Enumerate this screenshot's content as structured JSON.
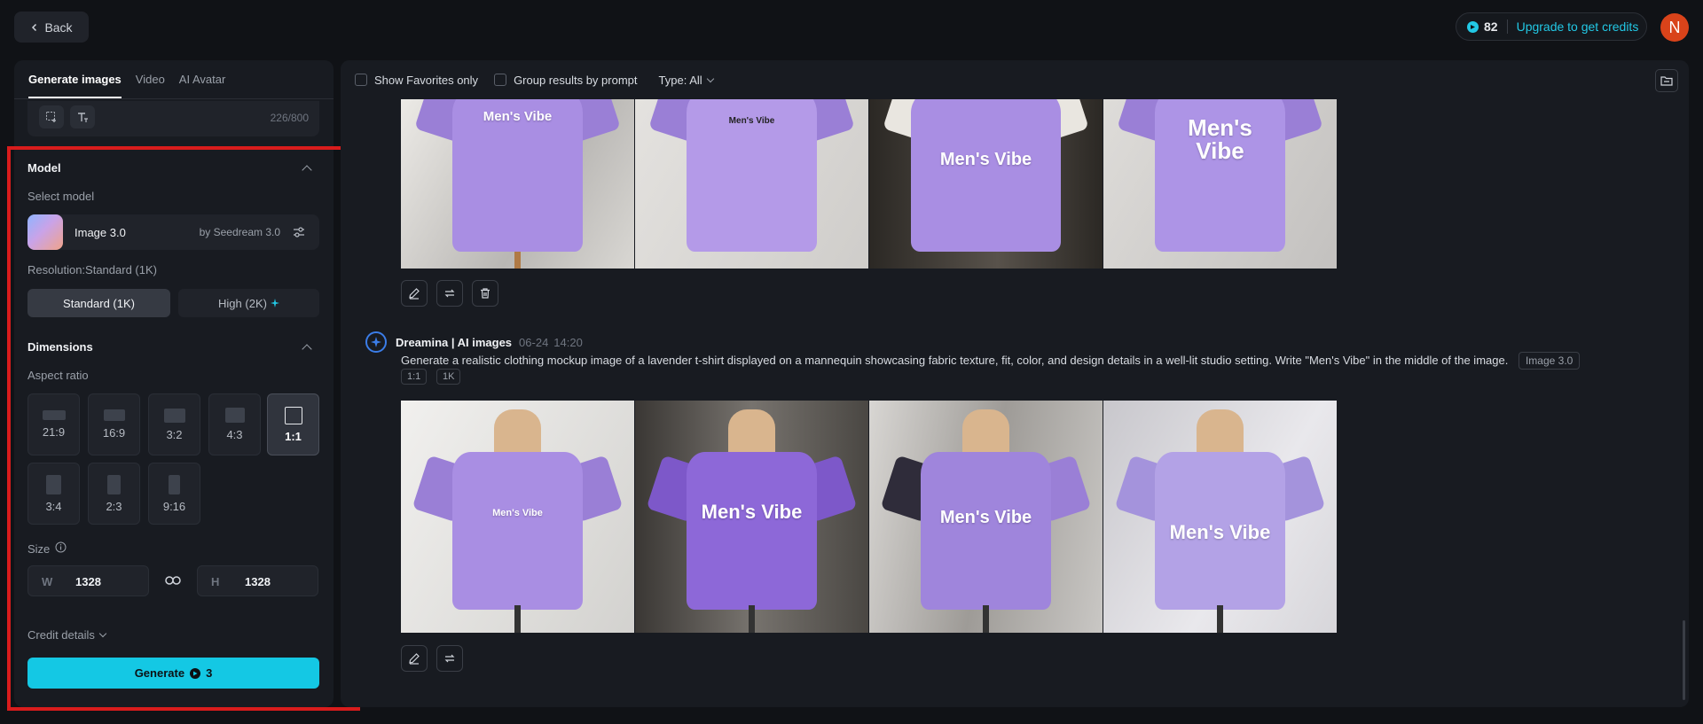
{
  "topbar": {
    "back_label": "Back",
    "credits": "82",
    "upgrade_label": "Upgrade to get credits",
    "avatar_initial": "N"
  },
  "left_panel": {
    "tabs": [
      {
        "label": "Generate images",
        "active": true
      },
      {
        "label": "Video",
        "active": false
      },
      {
        "label": "AI Avatar",
        "active": false
      }
    ],
    "prompt_char_count": "226/800",
    "model_section": {
      "title": "Model",
      "select_label": "Select model",
      "model_name": "Image 3.0",
      "model_by": "by Seedream 3.0",
      "resolution_label": "Resolution:Standard (1K)",
      "res_standard": "Standard (1K)",
      "res_high": "High (2K)"
    },
    "dimensions_section": {
      "title": "Dimensions",
      "aspect_label": "Aspect ratio",
      "aspect_ratios": [
        "21:9",
        "16:9",
        "3:2",
        "4:3",
        "1:1",
        "3:4",
        "2:3",
        "9:16"
      ],
      "selected_aspect": "1:1",
      "size_label": "Size",
      "width_key": "W",
      "width_value": "1328",
      "height_key": "H",
      "height_value": "1328"
    },
    "credit_details_label": "Credit details",
    "generate_label": "Generate",
    "generate_cost": "3"
  },
  "right_panel": {
    "filters": {
      "show_favorites": "Show Favorites only",
      "group_by_prompt": "Group results by prompt",
      "type_label": "Type: All"
    },
    "top_images": [
      {
        "text": "Men's Vibe"
      },
      {
        "text": "Men's Vibe"
      },
      {
        "text": "Men's Vibe"
      },
      {
        "text": "Men's Vibe"
      }
    ],
    "generation": {
      "source": "Dreamina | AI images",
      "date": "06-24",
      "time": "14:20",
      "prompt": "Generate a realistic clothing mockup image of a lavender t-shirt displayed on a mannequin showcasing fabric texture, fit, color, and design details in a well-lit studio setting. Write \"Men's Vibe\" in the middle of the image.",
      "model_tag": "Image 3.0",
      "chip_ratio": "1:1",
      "chip_res": "1K",
      "images": [
        {
          "text": "Men's Vibe"
        },
        {
          "text": "Men's Vibe"
        },
        {
          "text": "Men's Vibe"
        },
        {
          "text": "Men's Vibe"
        }
      ]
    }
  },
  "colors": {
    "accent": "#14c8e4",
    "highlight": "#d91c1c",
    "shirt": "#a98ee3",
    "avatar": "#d9431a"
  }
}
